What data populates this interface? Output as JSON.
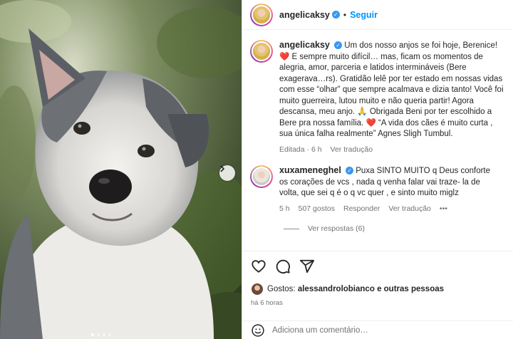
{
  "post": {
    "author": "angelicaksy",
    "separator": "•",
    "follow_label": "Seguir"
  },
  "caption": {
    "author": "angelicaksy",
    "text": "Um dos nosso anjos se foi hoje, Berenice!❤️ E sempre muito difícil… mas, ficam os momentos de alegria, amor, parceria e latidos intermináveis (Bere exagerava…rs). Gratidão lelê por ter estado em nossas vidas com esse “olhar” que sempre acalmava e dizia tanto! Você foi muito guerreira, lutou muito e não queria partir! Agora descansa, meu anjo. 🙏 Obrigada Beni por ter escolhido a Bere pra nossa família. ❤️ “A vida dos cães é muito curta , sua única falha realmente” Agnes Sligh Tumbul.",
    "edited_time": "Editada · 6 h",
    "see_translation": "Ver tradução"
  },
  "comment": {
    "author": "xuxameneghel",
    "text": "Puxa SINTO MUITO q Deus conforte os corações de vcs , nada q venha falar vai traze- la de volta, que sei q é o q vc quer , e sinto muito miglz",
    "time": "5 h",
    "likes": "507 gostos",
    "reply": "Responder",
    "see_translation": "Ver tradução",
    "more": "•••",
    "view_replies": "Ver respostas (6)"
  },
  "likes": {
    "prefix": "Gostos:",
    "user": "alessandrolobianco",
    "suffix": "e outras pessoas"
  },
  "posted_time": "há 6 horas",
  "add_comment_placeholder": "Adiciona um comentário…",
  "colors": {
    "link": "#0095f6",
    "verified": "#3897f0",
    "secondary": "#737373",
    "heart": "#ed4956"
  },
  "carousel": {
    "slides": 4,
    "active": 1
  }
}
